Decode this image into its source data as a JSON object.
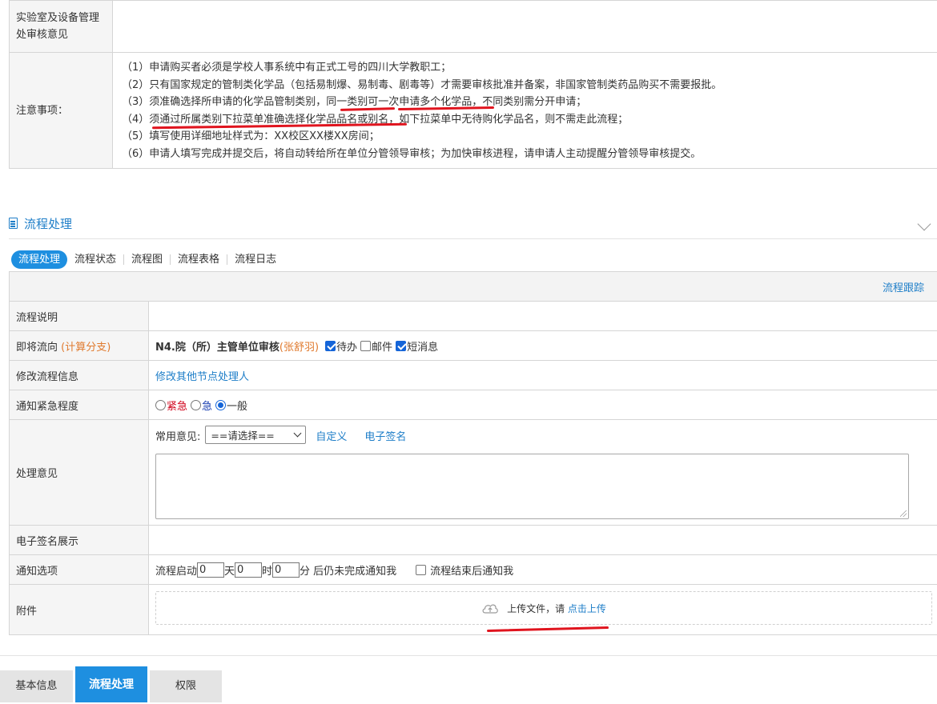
{
  "notice": {
    "lab_review_label": "实验室及设备管理处审核意见",
    "notes_label": "注意事项：",
    "notes": [
      "（1）申请购买者必须是学校人事系统中有正式工号的四川大学教职工；",
      "（2）只有国家规定的管制类化学品（包括易制爆、易制毒、剧毒等）才需要审核批准并备案，非国家管制类药品购买不需要报批。",
      "（3）须准确选择所申请的化学品管制类别，同一类别可一次申请多个化学品，不同类别需分开申请；",
      "（4）须通过所属类别下拉菜单准确选择化学品品名或别名，如下拉菜单中无待购化学品名，则不需走此流程；",
      "（5）填写使用详细地址样式为：XX校区XX楼XX房间；",
      "（6）申请人填写完成并提交后，将自动转给所在单位分管领导审核；为加快审核进程，请申请人主动提醒分管领导审核提交。"
    ]
  },
  "section": {
    "title": "流程处理"
  },
  "tabs": [
    "流程处理",
    "流程状态",
    "流程图",
    "流程表格",
    "流程日志"
  ],
  "form": {
    "trace_link": "流程跟踪",
    "rows": {
      "desc_label": "流程说明",
      "next_label": "即将流向",
      "next_branch": "(计算分支)",
      "next_node": "N4.院（所）主管单位审核",
      "next_person": "(张舒羽)",
      "notify_todo": "待办",
      "notify_mail": "邮件",
      "notify_sms": "短消息",
      "modify_label": "修改流程信息",
      "modify_link": "修改其他节点处理人",
      "urgency_label": "通知紧急程度",
      "urgency_options": [
        "紧急",
        "急",
        "一般"
      ],
      "opinion_label": "处理意见",
      "common_opinion_label": "常用意见:",
      "common_opinion_selected": "==请选择==",
      "custom_link": "自定义",
      "esign_link": "电子签名",
      "esign_show_label": "电子签名展示",
      "notify_opt_label": "通知选项",
      "notify_start": "流程启动",
      "day_value": "0",
      "day_unit": "天",
      "hour_value": "0",
      "hour_unit": "时",
      "minute_value": "0",
      "minute_unit": "分",
      "notify_tail": "后仍未完成通知我",
      "notify_end": "流程结束后通知我",
      "attach_label": "附件",
      "upload_text": "上传文件，请",
      "upload_link": "点击上传"
    }
  },
  "bottom_tabs": [
    "基本信息",
    "流程处理",
    "权限"
  ],
  "colors": {
    "accent": "#1e8fe0",
    "link": "#1e7ec8",
    "annotation": "#e0141e",
    "branch": "#e07a2e"
  }
}
